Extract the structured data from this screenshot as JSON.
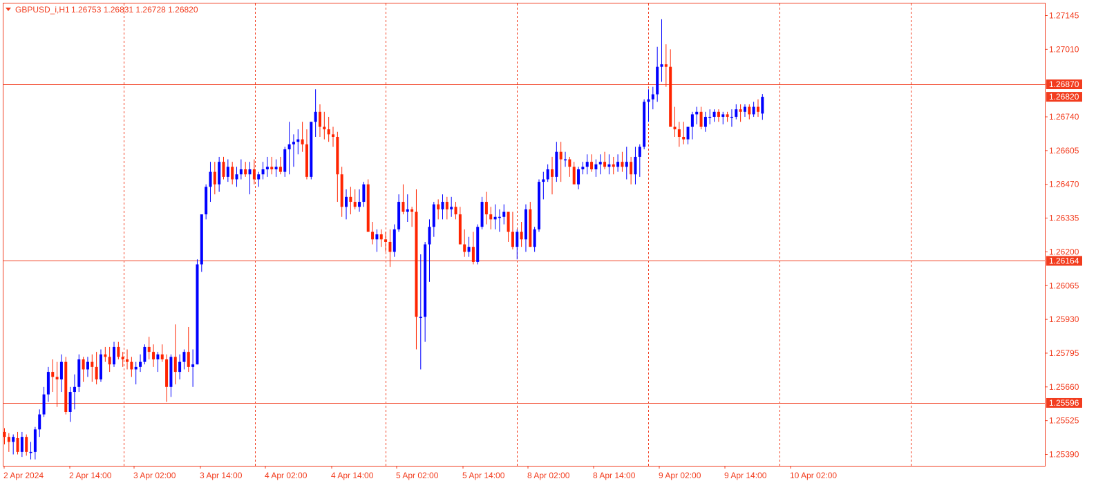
{
  "header": {
    "symbol": "GBPUSD_i,H1",
    "ohlc": "1.26753 1.26831 1.26728 1.26820",
    "menu_icon": "triangle-down-icon"
  },
  "colors": {
    "bull": "#0000ff",
    "bear": "#ff2400",
    "frame": "#f23c1e",
    "grid": "#f23c1e",
    "level_line": "#f23c1e",
    "tag_bg": "#f23c1e",
    "background": "#ffffff"
  },
  "chart_data": {
    "type": "candlestick",
    "title": "GBPUSD_i,H1",
    "y_ticks": [
      "1.27145",
      "1.27010",
      "1.26870",
      "1.26740",
      "1.26605",
      "1.26470",
      "1.26335",
      "1.26200",
      "1.26065",
      "1.25930",
      "1.25795",
      "1.25660",
      "1.25525",
      "1.25390"
    ],
    "ylim": [
      1.2533,
      1.272
    ],
    "x_labels": [
      "2 Apr 2024",
      "2 Apr 14:00",
      "3 Apr 02:00",
      "3 Apr 14:00",
      "4 Apr 02:00",
      "4 Apr 14:00",
      "5 Apr 02:00",
      "5 Apr 14:00",
      "8 Apr 02:00",
      "8 Apr 14:00",
      "9 Apr 02:00",
      "9 Apr 14:00",
      "10 Apr 02:00"
    ],
    "grid": "vertical-dashed",
    "levels": [
      {
        "value": 1.2687,
        "label": "1.26870",
        "kind": "level"
      },
      {
        "value": 1.2682,
        "label": "1.26820",
        "kind": "current-price"
      },
      {
        "value": 1.26164,
        "label": "1.26164",
        "kind": "level"
      },
      {
        "value": 1.25596,
        "label": "1.25596",
        "kind": "level"
      }
    ],
    "candles": [
      [
        1.2548,
        1.25495,
        1.2543,
        1.2546
      ],
      [
        1.2546,
        1.25475,
        1.254,
        1.2544
      ],
      [
        1.2544,
        1.2547,
        1.2539,
        1.2546
      ],
      [
        1.25455,
        1.2548,
        1.2539,
        1.254
      ],
      [
        1.254,
        1.2548,
        1.2538,
        1.2546
      ],
      [
        1.2546,
        1.2547,
        1.25385,
        1.254
      ],
      [
        1.254,
        1.2544,
        1.2537,
        1.254
      ],
      [
        1.254,
        1.255,
        1.2537,
        1.2549
      ],
      [
        1.2549,
        1.2557,
        1.2546,
        1.2555
      ],
      [
        1.2555,
        1.2566,
        1.2554,
        1.2563
      ],
      [
        1.2563,
        1.2574,
        1.256,
        1.2572
      ],
      [
        1.2572,
        1.2577,
        1.2564,
        1.257
      ],
      [
        1.257,
        1.2576,
        1.2558,
        1.2569
      ],
      [
        1.2569,
        1.2579,
        1.2564,
        1.2576
      ],
      [
        1.2576,
        1.2578,
        1.2555,
        1.2556
      ],
      [
        1.2556,
        1.2566,
        1.2552,
        1.2564
      ],
      [
        1.2564,
        1.2571,
        1.2557,
        1.2566
      ],
      [
        1.2566,
        1.2579,
        1.2564,
        1.2577
      ],
      [
        1.2577,
        1.2578,
        1.2568,
        1.2573
      ],
      [
        1.2573,
        1.2578,
        1.257,
        1.2576
      ],
      [
        1.2576,
        1.2579,
        1.2568,
        1.2574
      ],
      [
        1.2574,
        1.258,
        1.2567,
        1.2569
      ],
      [
        1.2569,
        1.2581,
        1.2568,
        1.2579
      ],
      [
        1.2579,
        1.2582,
        1.2576,
        1.2578
      ],
      [
        1.2578,
        1.2582,
        1.2572,
        1.2575
      ],
      [
        1.2575,
        1.2584,
        1.2574,
        1.2582
      ],
      [
        1.2582,
        1.2584,
        1.2577,
        1.2578
      ],
      [
        1.2578,
        1.258,
        1.2574,
        1.2577
      ],
      [
        1.2577,
        1.2581,
        1.2573,
        1.2576
      ],
      [
        1.2576,
        1.2578,
        1.257,
        1.2573
      ],
      [
        1.2573,
        1.2576,
        1.2567,
        1.2574
      ],
      [
        1.2574,
        1.2579,
        1.2572,
        1.2576
      ],
      [
        1.2576,
        1.2583,
        1.2575,
        1.2582
      ],
      [
        1.2582,
        1.2586,
        1.2577,
        1.258
      ],
      [
        1.258,
        1.2583,
        1.2574,
        1.2577
      ],
      [
        1.2577,
        1.258,
        1.2572,
        1.2579
      ],
      [
        1.2579,
        1.2583,
        1.2576,
        1.2577
      ],
      [
        1.2577,
        1.2579,
        1.256,
        1.2566
      ],
      [
        1.2566,
        1.2579,
        1.2562,
        1.2578
      ],
      [
        1.2578,
        1.2591,
        1.2567,
        1.2572
      ],
      [
        1.2572,
        1.2579,
        1.2569,
        1.2576
      ],
      [
        1.2576,
        1.2581,
        1.2573,
        1.258
      ],
      [
        1.258,
        1.259,
        1.2572,
        1.2574
      ],
      [
        1.2574,
        1.2581,
        1.2566,
        1.2575
      ],
      [
        1.2575,
        1.2617,
        1.2575,
        1.2615
      ],
      [
        1.2615,
        1.2625,
        1.2612,
        1.2635
      ],
      [
        1.2635,
        1.2647,
        1.2633,
        1.2646
      ],
      [
        1.2646,
        1.2656,
        1.264,
        1.2652
      ],
      [
        1.2652,
        1.2656,
        1.2643,
        1.2647
      ],
      [
        1.2647,
        1.2658,
        1.2644,
        1.2656
      ],
      [
        1.2656,
        1.2658,
        1.2649,
        1.265
      ],
      [
        1.265,
        1.2657,
        1.2648,
        1.2654
      ],
      [
        1.2654,
        1.2656,
        1.2647,
        1.2649
      ],
      [
        1.2649,
        1.2654,
        1.2646,
        1.2651
      ],
      [
        1.2651,
        1.2657,
        1.2649,
        1.2653
      ],
      [
        1.2653,
        1.2656,
        1.265,
        1.2651
      ],
      [
        1.2651,
        1.2656,
        1.2643,
        1.2653
      ],
      [
        1.2653,
        1.2657,
        1.2647,
        1.2649
      ],
      [
        1.2649,
        1.2652,
        1.2646,
        1.2651
      ],
      [
        1.2651,
        1.2656,
        1.2649,
        1.2653
      ],
      [
        1.2653,
        1.2658,
        1.265,
        1.2654
      ],
      [
        1.2654,
        1.2658,
        1.2651,
        1.2653
      ],
      [
        1.2653,
        1.2657,
        1.265,
        1.2654
      ],
      [
        1.2654,
        1.2658,
        1.2651,
        1.2652
      ],
      [
        1.2652,
        1.2662,
        1.265,
        1.2661
      ],
      [
        1.2661,
        1.2672,
        1.2651,
        1.2663
      ],
      [
        1.2663,
        1.2667,
        1.2654,
        1.2664
      ],
      [
        1.2664,
        1.2669,
        1.2659,
        1.2665
      ],
      [
        1.2665,
        1.2672,
        1.266,
        1.2663
      ],
      [
        1.2663,
        1.2669,
        1.2649,
        1.265
      ],
      [
        1.265,
        1.2672,
        1.2649,
        1.2672
      ],
      [
        1.2672,
        1.2685,
        1.2666,
        1.2676
      ],
      [
        1.2676,
        1.2679,
        1.2666,
        1.267
      ],
      [
        1.267,
        1.2676,
        1.2665,
        1.2669
      ],
      [
        1.2669,
        1.2674,
        1.2664,
        1.2667
      ],
      [
        1.2667,
        1.267,
        1.2662,
        1.2666
      ],
      [
        1.2666,
        1.2668,
        1.264,
        1.2651
      ],
      [
        1.2651,
        1.2654,
        1.2634,
        1.2638
      ],
      [
        1.2638,
        1.2645,
        1.2633,
        1.2642
      ],
      [
        1.2642,
        1.2646,
        1.2635,
        1.264
      ],
      [
        1.264,
        1.2645,
        1.2637,
        1.2638
      ],
      [
        1.2638,
        1.2645,
        1.2636,
        1.264
      ],
      [
        1.264,
        1.2648,
        1.2638,
        1.2647
      ],
      [
        1.2647,
        1.2649,
        1.2628,
        1.2628
      ],
      [
        1.2628,
        1.2632,
        1.2623,
        1.2625
      ],
      [
        1.2625,
        1.2629,
        1.262,
        1.2627
      ],
      [
        1.2627,
        1.2629,
        1.2622,
        1.2625
      ],
      [
        1.2625,
        1.2628,
        1.262,
        1.2624
      ],
      [
        1.2624,
        1.2629,
        1.2614,
        1.262
      ],
      [
        1.262,
        1.2631,
        1.2618,
        1.2629
      ],
      [
        1.2629,
        1.2643,
        1.2628,
        1.264
      ],
      [
        1.264,
        1.2647,
        1.2635,
        1.2636
      ],
      [
        1.2636,
        1.2643,
        1.2632,
        1.2637
      ],
      [
        1.2637,
        1.2638,
        1.263,
        1.2636
      ],
      [
        1.2636,
        1.2645,
        1.2581,
        1.2594
      ],
      [
        1.2594,
        1.2619,
        1.2573,
        1.2594
      ],
      [
        1.2594,
        1.2624,
        1.2584,
        1.2623
      ],
      [
        1.2623,
        1.2633,
        1.2608,
        1.263
      ],
      [
        1.263,
        1.264,
        1.2626,
        1.2639
      ],
      [
        1.2639,
        1.2641,
        1.2633,
        1.2637
      ],
      [
        1.2637,
        1.2643,
        1.2633,
        1.264
      ],
      [
        1.264,
        1.2642,
        1.2633,
        1.2637
      ],
      [
        1.2637,
        1.2642,
        1.2634,
        1.2638
      ],
      [
        1.2638,
        1.264,
        1.2633,
        1.2635
      ],
      [
        1.2635,
        1.2638,
        1.2628,
        1.2623
      ],
      [
        1.2623,
        1.2629,
        1.2618,
        1.262
      ],
      [
        1.262,
        1.2626,
        1.2618,
        1.2622
      ],
      [
        1.2622,
        1.2628,
        1.2615,
        1.2616
      ],
      [
        1.2616,
        1.2631,
        1.2615,
        1.263
      ],
      [
        1.263,
        1.2642,
        1.2629,
        1.264
      ],
      [
        1.264,
        1.2644,
        1.2631,
        1.2635
      ],
      [
        1.2635,
        1.2638,
        1.2629,
        1.2633
      ],
      [
        1.2633,
        1.2639,
        1.2629,
        1.2634
      ],
      [
        1.2634,
        1.2637,
        1.2628,
        1.2634
      ],
      [
        1.2634,
        1.2639,
        1.2631,
        1.2636
      ],
      [
        1.2636,
        1.2636,
        1.2624,
        1.2628
      ],
      [
        1.2628,
        1.2636,
        1.2621,
        1.2622
      ],
      [
        1.2622,
        1.2629,
        1.2617,
        1.2628
      ],
      [
        1.2628,
        1.2632,
        1.2622,
        1.2625
      ],
      [
        1.2625,
        1.2639,
        1.262,
        1.2637
      ],
      [
        1.2637,
        1.264,
        1.2622,
        1.2622
      ],
      [
        1.2622,
        1.263,
        1.262,
        1.2629
      ],
      [
        1.2629,
        1.2649,
        1.2628,
        1.2648
      ],
      [
        1.2648,
        1.2652,
        1.2641,
        1.2649
      ],
      [
        1.2649,
        1.2655,
        1.2648,
        1.2653
      ],
      [
        1.2653,
        1.2658,
        1.2643,
        1.265
      ],
      [
        1.265,
        1.2664,
        1.2648,
        1.266
      ],
      [
        1.266,
        1.2664,
        1.2648,
        1.2657
      ],
      [
        1.2657,
        1.266,
        1.2654,
        1.2657
      ],
      [
        1.2657,
        1.2658,
        1.265,
        1.2654
      ],
      [
        1.2654,
        1.2656,
        1.2649,
        1.2647
      ],
      [
        1.2647,
        1.2654,
        1.2645,
        1.2653
      ],
      [
        1.2653,
        1.2656,
        1.2651,
        1.2654
      ],
      [
        1.2654,
        1.2659,
        1.2651,
        1.2656
      ],
      [
        1.2656,
        1.2659,
        1.2652,
        1.2653
      ],
      [
        1.2653,
        1.2657,
        1.265,
        1.2655
      ],
      [
        1.2655,
        1.2659,
        1.2651,
        1.2656
      ],
      [
        1.2656,
        1.266,
        1.2653,
        1.2654
      ],
      [
        1.2654,
        1.2659,
        1.2651,
        1.2655
      ],
      [
        1.2655,
        1.2658,
        1.2651,
        1.2654
      ],
      [
        1.2654,
        1.2659,
        1.2652,
        1.2656
      ],
      [
        1.2656,
        1.266,
        1.2652,
        1.2654
      ],
      [
        1.2654,
        1.2662,
        1.2649,
        1.2656
      ],
      [
        1.2656,
        1.2658,
        1.2647,
        1.2651
      ],
      [
        1.2651,
        1.2662,
        1.2647,
        1.2658
      ],
      [
        1.2658,
        1.2663,
        1.265,
        1.2662
      ],
      [
        1.2662,
        1.2681,
        1.2661,
        1.268
      ],
      [
        1.268,
        1.2685,
        1.2672,
        1.2681
      ],
      [
        1.2681,
        1.2686,
        1.2677,
        1.2683
      ],
      [
        1.2683,
        1.2702,
        1.268,
        1.2694
      ],
      [
        1.2694,
        1.2713,
        1.2688,
        1.2695
      ],
      [
        1.2695,
        1.2703,
        1.2686,
        1.2694
      ],
      [
        1.2694,
        1.2701,
        1.2671,
        1.267
      ],
      [
        1.267,
        1.2678,
        1.2666,
        1.2669
      ],
      [
        1.2669,
        1.2672,
        1.2662,
        1.2666
      ],
      [
        1.2666,
        1.2672,
        1.2663,
        1.2665
      ],
      [
        1.2665,
        1.267,
        1.2663,
        1.267
      ],
      [
        1.267,
        1.2676,
        1.2665,
        1.2675
      ],
      [
        1.2675,
        1.2678,
        1.2671,
        1.2676
      ],
      [
        1.2676,
        1.2678,
        1.2669,
        1.267
      ],
      [
        1.267,
        1.2676,
        1.2668,
        1.2674
      ],
      [
        1.2674,
        1.2677,
        1.2671,
        1.2674
      ],
      [
        1.2674,
        1.2677,
        1.2672,
        1.2676
      ],
      [
        1.2676,
        1.2677,
        1.2672,
        1.2674
      ],
      [
        1.2674,
        1.2676,
        1.2671,
        1.2675
      ],
      [
        1.2675,
        1.2676,
        1.2672,
        1.2674
      ],
      [
        1.2674,
        1.2677,
        1.267,
        1.2674
      ],
      [
        1.2674,
        1.2679,
        1.2673,
        1.2677
      ],
      [
        1.2677,
        1.2679,
        1.2672,
        1.2676
      ],
      [
        1.2676,
        1.2679,
        1.2674,
        1.2678
      ],
      [
        1.2678,
        1.2679,
        1.2673,
        1.2675
      ],
      [
        1.2675,
        1.268,
        1.2674,
        1.2678
      ],
      [
        1.2678,
        1.2681,
        1.2674,
        1.2676
      ],
      [
        1.26753,
        1.26831,
        1.26728,
        1.2682
      ]
    ]
  }
}
